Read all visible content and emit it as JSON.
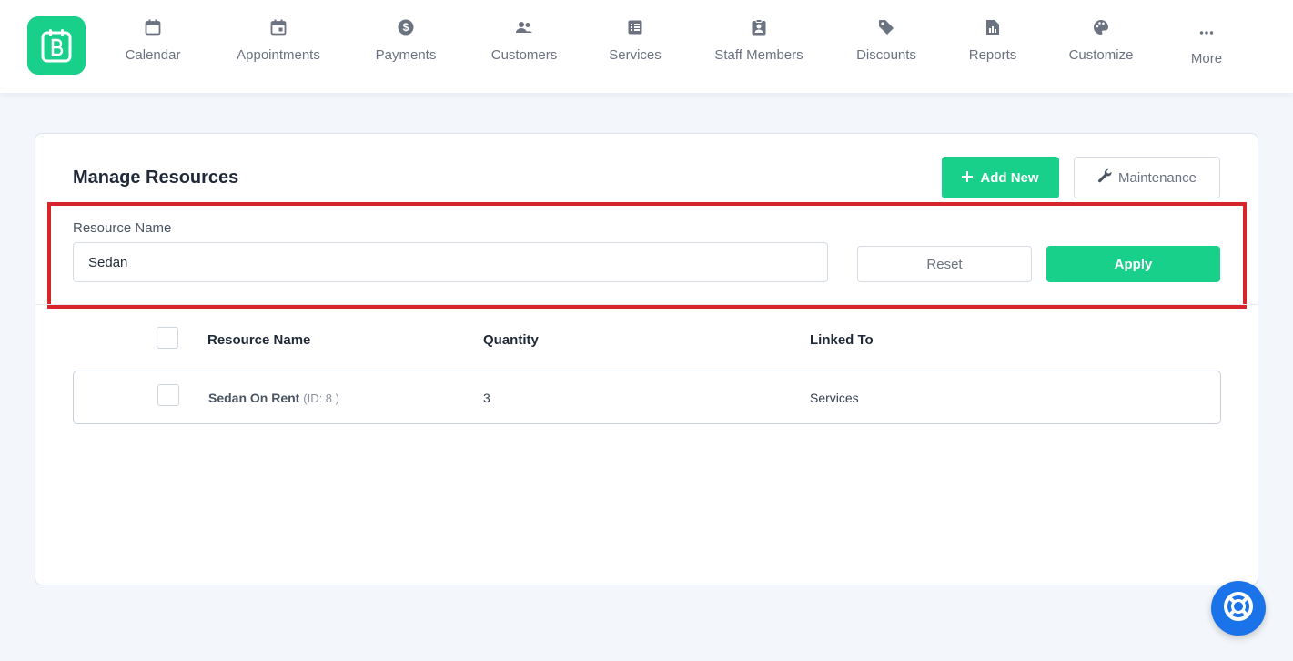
{
  "nav": {
    "items": [
      {
        "label": "Calendar",
        "icon": "calendar-icon"
      },
      {
        "label": "Appointments",
        "icon": "calendar-event-icon"
      },
      {
        "label": "Payments",
        "icon": "dollar-circle-icon"
      },
      {
        "label": "Customers",
        "icon": "users-icon"
      },
      {
        "label": "Services",
        "icon": "list-icon"
      },
      {
        "label": "Staff Members",
        "icon": "clipboard-user-icon"
      },
      {
        "label": "Discounts",
        "icon": "tag-icon"
      },
      {
        "label": "Reports",
        "icon": "report-icon"
      },
      {
        "label": "Customize",
        "icon": "palette-icon"
      },
      {
        "label": "More",
        "icon": "more-dots-icon"
      }
    ]
  },
  "page": {
    "title": "Manage Resources",
    "add_label": "Add New",
    "maintenance_label": "Maintenance"
  },
  "filter": {
    "label": "Resource Name",
    "value": "Sedan",
    "reset_label": "Reset",
    "apply_label": "Apply"
  },
  "table": {
    "headers": [
      "Resource Name",
      "Quantity",
      "Linked To"
    ],
    "rows": [
      {
        "name": "Sedan On Rent",
        "id": "(ID: 8 )",
        "quantity": "3",
        "linked_to": "Services"
      }
    ]
  },
  "colors": {
    "accent": "#18d08a",
    "highlight_border": "#d7262b",
    "help_button": "#1a73e8"
  }
}
